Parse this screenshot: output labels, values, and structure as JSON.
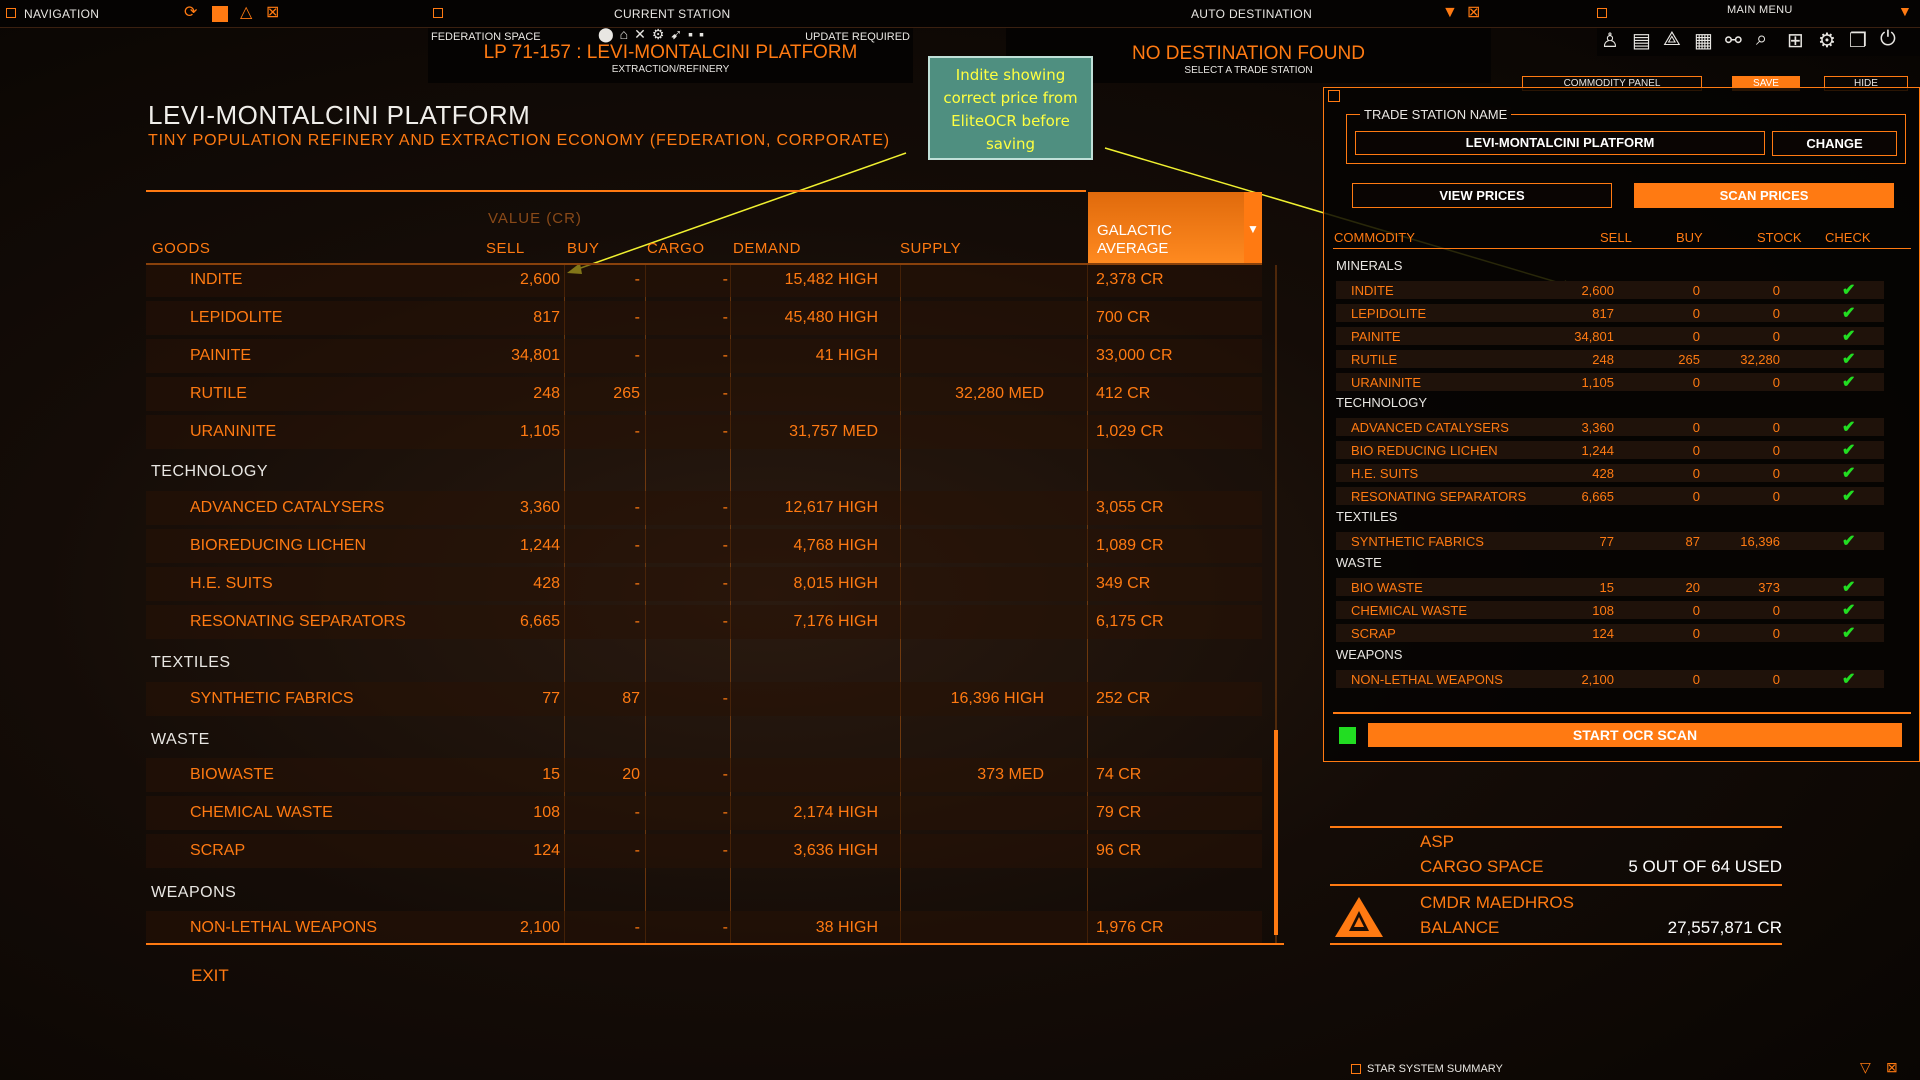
{
  "topbar": {
    "navigation": "NAVIGATION",
    "current_station": "CURRENT STATION",
    "auto_destination": "AUTO DESTINATION",
    "main_menu": "MAIN MENU"
  },
  "station_info": {
    "space": "FEDERATION SPACE",
    "update": "UPDATE REQUIRED",
    "name": "LP 71-157 : LEVI-MONTALCINI PLATFORM",
    "type": "EXTRACTION/REFINERY"
  },
  "destination": {
    "status": "NO DESTINATION FOUND",
    "hint": "SELECT A TRADE STATION"
  },
  "market": {
    "title": "LEVI-MONTALCINI PLATFORM",
    "subtitle": "TINY POPULATION REFINERY AND EXTRACTION ECONOMY (FEDERATION, CORPORATE)",
    "value_header": "VALUE (CR)",
    "columns": {
      "goods": "GOODS",
      "sell": "SELL",
      "buy": "BUY",
      "cargo": "CARGO",
      "demand": "DEMAND",
      "supply": "SUPPLY",
      "galactic_average": "GALACTIC AVERAGE"
    },
    "categories": {
      "technology": "TECHNOLOGY",
      "textiles": "TEXTILES",
      "waste": "WASTE",
      "weapons": "WEAPONS"
    },
    "rows": [
      {
        "name": "INDITE",
        "sell": "2,600",
        "buy": "-",
        "cargo": "-",
        "demand": "15,482 HIGH",
        "supply": "",
        "avg": "2,378 CR"
      },
      {
        "name": "LEPIDOLITE",
        "sell": "817",
        "buy": "-",
        "cargo": "-",
        "demand": "45,480 HIGH",
        "supply": "",
        "avg": "700 CR"
      },
      {
        "name": "PAINITE",
        "sell": "34,801",
        "buy": "-",
        "cargo": "-",
        "demand": "41 HIGH",
        "supply": "",
        "avg": "33,000 CR"
      },
      {
        "name": "RUTILE",
        "sell": "248",
        "buy": "265",
        "cargo": "-",
        "demand": "",
        "supply": "32,280 MED",
        "avg": "412 CR"
      },
      {
        "name": "URANINITE",
        "sell": "1,105",
        "buy": "-",
        "cargo": "-",
        "demand": "31,757 MED",
        "supply": "",
        "avg": "1,029 CR"
      },
      {
        "name": "ADVANCED CATALYSERS",
        "sell": "3,360",
        "buy": "-",
        "cargo": "-",
        "demand": "12,617 HIGH",
        "supply": "",
        "avg": "3,055 CR"
      },
      {
        "name": "BIOREDUCING LICHEN",
        "sell": "1,244",
        "buy": "-",
        "cargo": "-",
        "demand": "4,768 HIGH",
        "supply": "",
        "avg": "1,089 CR"
      },
      {
        "name": "H.E. SUITS",
        "sell": "428",
        "buy": "-",
        "cargo": "-",
        "demand": "8,015 HIGH",
        "supply": "",
        "avg": "349 CR"
      },
      {
        "name": "RESONATING SEPARATORS",
        "sell": "6,665",
        "buy": "-",
        "cargo": "-",
        "demand": "7,176 HIGH",
        "supply": "",
        "avg": "6,175 CR"
      },
      {
        "name": "SYNTHETIC FABRICS",
        "sell": "77",
        "buy": "87",
        "cargo": "-",
        "demand": "",
        "supply": "16,396 HIGH",
        "avg": "252 CR"
      },
      {
        "name": "BIOWASTE",
        "sell": "15",
        "buy": "20",
        "cargo": "-",
        "demand": "",
        "supply": "373 MED",
        "avg": "74 CR"
      },
      {
        "name": "CHEMICAL WASTE",
        "sell": "108",
        "buy": "-",
        "cargo": "-",
        "demand": "2,174 HIGH",
        "supply": "",
        "avg": "79 CR"
      },
      {
        "name": "SCRAP",
        "sell": "124",
        "buy": "-",
        "cargo": "-",
        "demand": "3,636 HIGH",
        "supply": "",
        "avg": "96 CR"
      },
      {
        "name": "NON-LETHAL WEAPONS",
        "sell": "2,100",
        "buy": "-",
        "cargo": "-",
        "demand": "38 HIGH",
        "supply": "",
        "avg": "1,976 CR"
      }
    ],
    "exit": "EXIT"
  },
  "callout": {
    "lines": [
      "Indite showing",
      "correct price from",
      "EliteOCR before",
      "saving"
    ]
  },
  "ocr_panel": {
    "commodity_panel": "COMMODITY PANEL",
    "save": "SAVE",
    "hide": "HIDE",
    "trade_station_label": "TRADE STATION NAME",
    "station_value": "LEVI-MONTALCINI PLATFORM",
    "change": "CHANGE",
    "view_prices": "VIEW PRICES",
    "scan_prices": "SCAN PRICES",
    "columns": {
      "commodity": "COMMODITY",
      "sell": "SELL",
      "buy": "BUY",
      "stock": "STOCK",
      "check": "CHECK"
    },
    "categories": {
      "minerals": "MINERALS",
      "technology": "TECHNOLOGY",
      "textiles": "TEXTILES",
      "waste": "WASTE",
      "weapons": "WEAPONS"
    },
    "rows": [
      {
        "name": "INDITE",
        "sell": "2,600",
        "buy": "0",
        "stock": "0",
        "check": "✔"
      },
      {
        "name": "LEPIDOLITE",
        "sell": "817",
        "buy": "0",
        "stock": "0",
        "check": "✔"
      },
      {
        "name": "PAINITE",
        "sell": "34,801",
        "buy": "0",
        "stock": "0",
        "check": "✔"
      },
      {
        "name": "RUTILE",
        "sell": "248",
        "buy": "265",
        "stock": "32,280",
        "check": "✔"
      },
      {
        "name": "URANINITE",
        "sell": "1,105",
        "buy": "0",
        "stock": "0",
        "check": "✔"
      },
      {
        "name": "ADVANCED CATALYSERS",
        "sell": "3,360",
        "buy": "0",
        "stock": "0",
        "check": "✔"
      },
      {
        "name": "BIO REDUCING LICHEN",
        "sell": "1,244",
        "buy": "0",
        "stock": "0",
        "check": "✔"
      },
      {
        "name": "H.E. SUITS",
        "sell": "428",
        "buy": "0",
        "stock": "0",
        "check": "✔"
      },
      {
        "name": "RESONATING SEPARATORS",
        "sell": "6,665",
        "buy": "0",
        "stock": "0",
        "check": "✔"
      },
      {
        "name": "SYNTHETIC FABRICS",
        "sell": "77",
        "buy": "87",
        "stock": "16,396",
        "check": "✔"
      },
      {
        "name": "BIO WASTE",
        "sell": "15",
        "buy": "20",
        "stock": "373",
        "check": "✔"
      },
      {
        "name": "CHEMICAL WASTE",
        "sell": "108",
        "buy": "0",
        "stock": "0",
        "check": "✔"
      },
      {
        "name": "SCRAP",
        "sell": "124",
        "buy": "0",
        "stock": "0",
        "check": "✔"
      },
      {
        "name": "NON-LETHAL WEAPONS",
        "sell": "2,100",
        "buy": "0",
        "stock": "0",
        "check": "✔"
      }
    ],
    "start_ocr": "START OCR SCAN"
  },
  "ship": {
    "name": "ASP",
    "cargo_label": "CARGO SPACE",
    "cargo_value": "5 OUT OF 64 USED",
    "cmdr": "CMDR MAEDHROS",
    "balance_label": "BALANCE",
    "balance_value": "27,557,871 CR"
  },
  "footer": {
    "star_system_summary": "STAR SYSTEM SUMMARY"
  },
  "colors": {
    "accent": "#ff7a12",
    "check": "#22dd22",
    "callout_bg": "#4f8f80",
    "callout_text": "#ffff40"
  }
}
